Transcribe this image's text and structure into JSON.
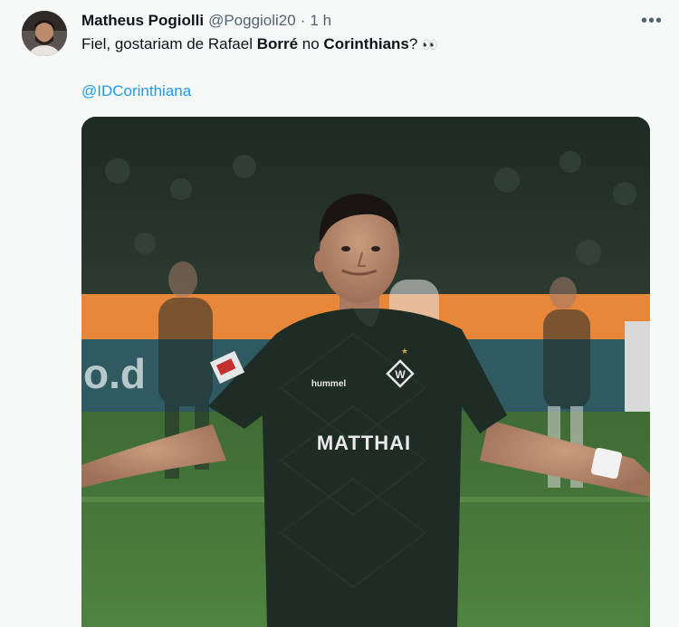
{
  "tweet": {
    "author_name": "Matheus Pogiolli",
    "author_handle": "@Poggioli20",
    "separator": "·",
    "time": "1 h",
    "more_label": "•••",
    "text_1": "Fiel, gostariam de Rafael ",
    "text_bold_1": "Borré",
    "text_2": " no ",
    "text_bold_2": "Corinthians",
    "text_3": "?",
    "emoji": "👀",
    "mention": "@IDCorinthiana"
  },
  "media": {
    "jersey_sponsor": "MATTHAI",
    "jersey_brand": "hummel",
    "board_text": "o.d"
  },
  "colors": {
    "link": "#1d9bf0",
    "secondary_text": "#536471",
    "background": "#f7f9f9",
    "jersey": "#1f2b25",
    "pitch": "#4a7a3a"
  }
}
